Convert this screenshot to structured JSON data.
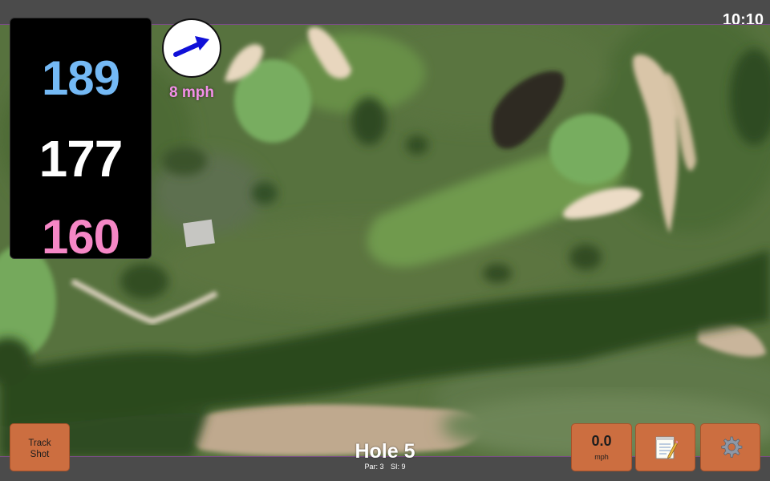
{
  "status": {
    "clock": "10:10"
  },
  "distances": {
    "back": "189",
    "middle": "177",
    "front": "160"
  },
  "wind": {
    "speed": "8 mph",
    "direction_icon": "arrow-icon"
  },
  "buttons": {
    "track_shot_line1": "Track",
    "track_shot_line2": "Shot",
    "speed_value": "0.0",
    "speed_unit": "mph",
    "scorecard_icon": "notepad-icon",
    "settings_icon": "gear-icon"
  },
  "hole": {
    "title": "Hole 5",
    "par": "Par: 3",
    "si": "SI: 9"
  },
  "colors": {
    "back_distance": "#74b9f5",
    "middle_distance": "#ffffff",
    "front_distance": "#f587c6",
    "wind_text": "#f38fe8",
    "button": "#cc6e40",
    "wind_arrow": "#1010d8"
  }
}
